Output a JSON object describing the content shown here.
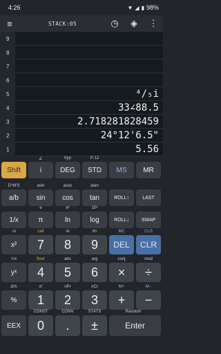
{
  "status": {
    "time": "4:26",
    "battery": "98%"
  },
  "toolbar": {
    "title": "STACK:05",
    "menu_icon": "hamburger-menu-icon",
    "clock_icon": "clock-icon",
    "layers_icon": "layers-icon",
    "more_icon": "more-vertical-icon"
  },
  "stack": {
    "rows": [
      {
        "index": "9",
        "value": ""
      },
      {
        "index": "8",
        "value": ""
      },
      {
        "index": "7",
        "value": ""
      },
      {
        "index": "6",
        "value": ""
      },
      {
        "index": "5",
        "value": "⁴/₅i"
      },
      {
        "index": "4",
        "value": "33∠88.5"
      },
      {
        "index": "3",
        "value": "2.718281828459"
      },
      {
        "index": "2",
        "value": "24°12'6.5\""
      },
      {
        "index": "1",
        "value": "5.56"
      }
    ]
  },
  "keys": {
    "r1": {
      "labels": [
        "",
        "∠",
        "hyp",
        "P:12",
        "",
        ""
      ],
      "keys": [
        "Shift",
        "i",
        "DEG",
        "STD",
        "MS",
        "MR"
      ]
    },
    "r2": {
      "labels": [
        "D°M'S",
        "asin",
        "acos",
        "atan",
        "",
        ""
      ],
      "keys": [
        "a/b",
        "sin",
        "cos",
        "tan",
        "ROLL↑",
        "LAST"
      ]
    },
    "r3": {
      "labels": [
        "",
        "e",
        "eˣ",
        "10ˣ",
        "",
        ""
      ],
      "keys": [
        "1/x",
        "π",
        "ln",
        "log",
        "ROLL↓",
        "SWAP"
      ]
    },
    "r4": {
      "labels": [
        "√x",
        "ceil",
        "re",
        "im",
        "MC",
        "CLS"
      ],
      "keys": [
        "x²",
        "7",
        "8",
        "9",
        "DEL",
        "CLR"
      ]
    },
    "r5": {
      "labels": [
        "ʸ√x",
        "floor",
        "abs",
        "arg",
        "conj",
        "mod"
      ],
      "keys": [
        "yˣ",
        "4",
        "5",
        "6",
        "×",
        "÷"
      ]
    },
    "r6": {
      "labels": [
        "Δ%",
        "x!",
        "nPr",
        "nCr",
        "M+",
        "M−"
      ],
      "keys": [
        "%",
        "1",
        "2",
        "3",
        "+",
        "−"
      ]
    },
    "r7": {
      "labels": [
        "",
        "CONST",
        "CONV",
        "STATS",
        "Random",
        ""
      ],
      "keys": [
        "EEX",
        "0",
        ".",
        "±",
        "Enter"
      ]
    }
  }
}
